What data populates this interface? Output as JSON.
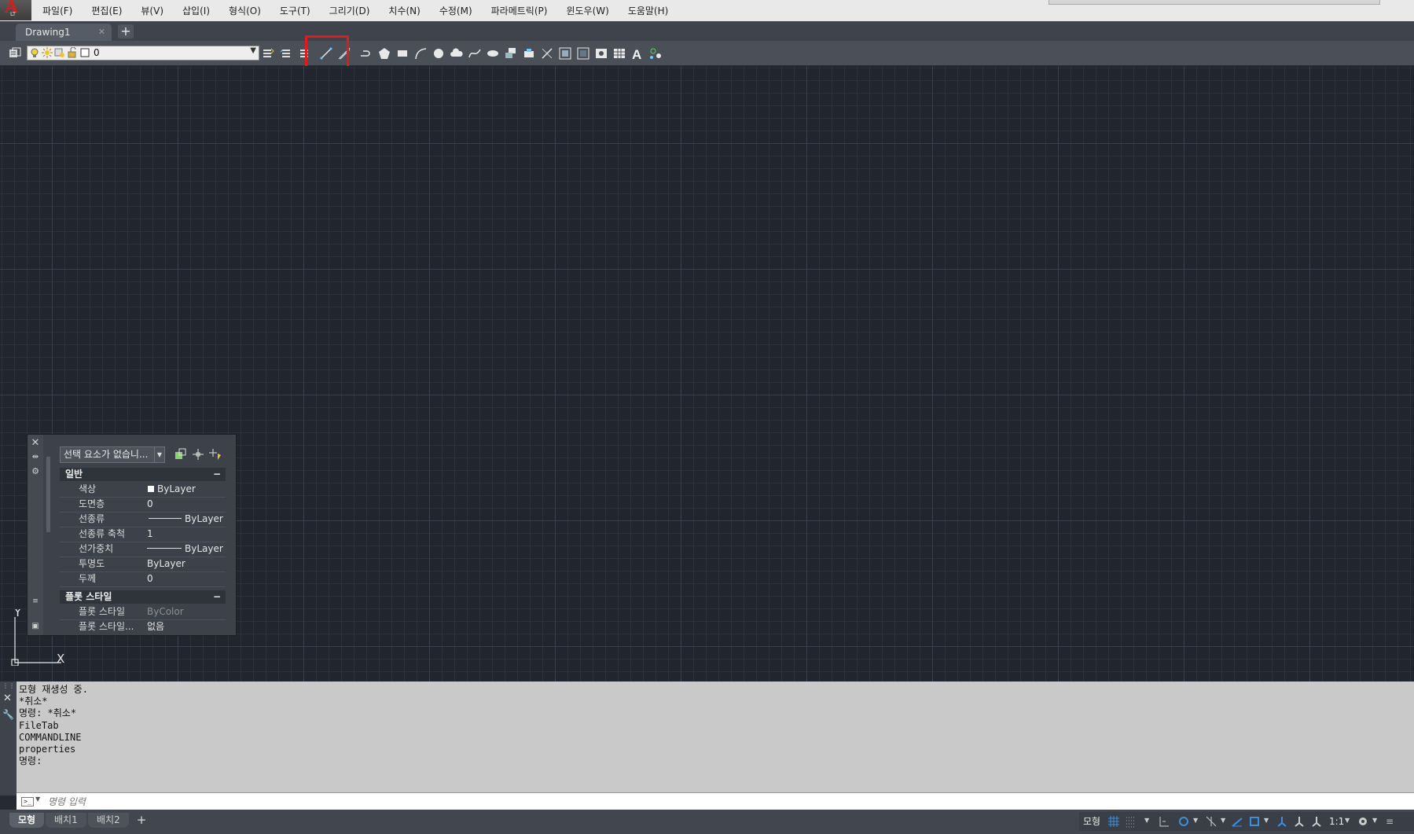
{
  "app": {
    "logo_letter": "A",
    "logo_sub": "LT"
  },
  "menu": {
    "items": [
      "파일(F)",
      "편집(E)",
      "뷰(V)",
      "삽입(I)",
      "형식(O)",
      "도구(T)",
      "그리기(D)",
      "치수(N)",
      "수정(M)",
      "파라메트릭(P)",
      "윈도우(W)",
      "도움말(H)"
    ]
  },
  "file_tabs": {
    "active": "Drawing1",
    "close_symbol": "✕",
    "add_symbol": "+"
  },
  "toolbar": {
    "layer_value": "0",
    "draw_tools": [
      "line-icon",
      "construction-line-icon",
      "polyline-icon",
      "polygon-icon",
      "rectangle-icon",
      "arc-icon",
      "circle-icon",
      "revision-cloud-icon",
      "spline-icon",
      "ellipse-icon",
      "ellipse-arc-icon",
      "insert-block-icon",
      "make-block-icon",
      "point-icon",
      "hatch-icon",
      "gradient-icon",
      "region-icon",
      "table-icon",
      "multiline-text-icon",
      "add-selected-icon"
    ],
    "highlighted_tool": "line-icon",
    "highlight_color": "#e11b1b"
  },
  "properties": {
    "selection": "선택 요소가 없습니...",
    "sections": [
      {
        "title": "일반",
        "collapse": "−",
        "rows": [
          {
            "name": "색상",
            "value": "ByLayer"
          },
          {
            "name": "도면층",
            "value": "0"
          },
          {
            "name": "선종류",
            "value": "ByLayer"
          },
          {
            "name": "선종류 축척",
            "value": "1"
          },
          {
            "name": "선가중치",
            "value": "ByLayer"
          },
          {
            "name": "투명도",
            "value": "ByLayer"
          },
          {
            "name": "두께",
            "value": "0"
          }
        ]
      },
      {
        "title": "플롯 스타일",
        "collapse": "−",
        "rows": [
          {
            "name": "플롯 스타일",
            "value": "ByColor"
          },
          {
            "name": "플롯 스타일...",
            "value": "없음"
          }
        ]
      }
    ]
  },
  "ucs": {
    "x_label": "X",
    "y_label": "Y"
  },
  "command": {
    "history": [
      "모형 재생성 중.",
      "*취소*",
      "명령: *취소*",
      "FileTab",
      "COMMANDLINE",
      "properties",
      "명령:"
    ],
    "input_placeholder": "명령 입력"
  },
  "status": {
    "layout_tabs": [
      "모형",
      "배치1",
      "배치2"
    ],
    "add_symbol": "+",
    "model_label": "모형",
    "scale": "1:1"
  },
  "colors": {
    "accent": "#3c8fe0",
    "canvas": "#21262e",
    "highlight": "#e11b1b"
  }
}
